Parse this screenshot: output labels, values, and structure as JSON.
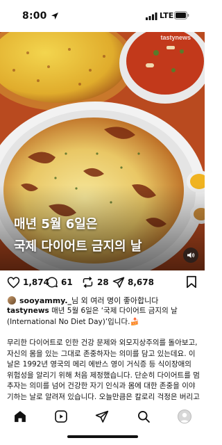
{
  "status_bar": {
    "time": "8:00",
    "network": "LTE"
  },
  "post": {
    "watermark": "tastynews",
    "overlay_line1": "매년 5월 6일은",
    "overlay_line2": "국제 다이어트 금지의 날",
    "likes": "1,874",
    "comments": "61",
    "reposts": "28",
    "shares": "8,678",
    "liked_by_user": "sooyammy._",
    "liked_by_suffix": "님 외 여러 명이 좋아합니다",
    "author": "tastynews",
    "caption_head": "매년 5월 6일은 ‘국제 다이어트 금지의 날(International No Diet Day)’입니다.🍰",
    "caption_body": "무리한 다이어트로 인한 건강 문제와 외모지상주의를 돌아보고, 자신의 몸을 있는 그대로 존중하자는 의미를 담고 있는데요. 이 날은 1992년 영국의 메리 에반스 영이 거식증 등 식이장애의 위험성을 알리기 위해 처음 제정했습니다. 단순히 다이어트를 멈추자는 의미를 넘어 건강한 자기 인식과 몸에 대한 존중을 이야기하는 날로 알려져 있습니다. 오늘만큼은 칼로리 걱정은 버리고 가족, 친구, 애인과 함께 맛있는 음식을 먹어보"
  },
  "icons": {
    "like": "heart-icon",
    "comment": "comment-icon",
    "repost": "repost-icon",
    "share": "send-icon",
    "save": "bookmark-icon",
    "home": "home-icon",
    "reels": "reels-icon",
    "messages": "paper-plane-icon",
    "search": "search-icon",
    "profile": "profile-avatar"
  }
}
